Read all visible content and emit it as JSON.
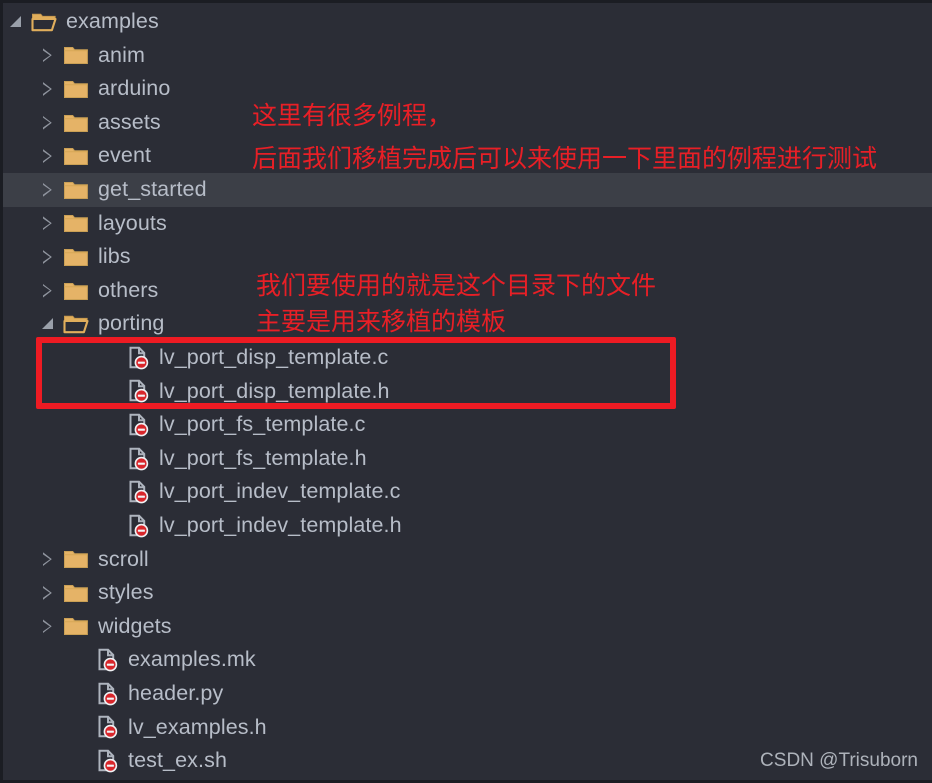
{
  "window": {
    "title": "examples",
    "background": "#2b2d36",
    "highlight_background": "#3c3f47",
    "text_color": "#b7bdc8",
    "folder_color": "#e0ae5c",
    "annotation_color": "#e81f26"
  },
  "tree": {
    "nodes": [
      {
        "label": "examples",
        "type": "folder-open",
        "level": 0,
        "state": "expanded",
        "highlighted": false
      },
      {
        "label": "anim",
        "type": "folder-closed",
        "level": 1,
        "state": "collapsed",
        "highlighted": false
      },
      {
        "label": "arduino",
        "type": "folder-closed",
        "level": 1,
        "state": "collapsed",
        "highlighted": false
      },
      {
        "label": "assets",
        "type": "folder-closed",
        "level": 1,
        "state": "collapsed",
        "highlighted": false
      },
      {
        "label": "event",
        "type": "folder-closed",
        "level": 1,
        "state": "collapsed",
        "highlighted": false
      },
      {
        "label": "get_started",
        "type": "folder-closed",
        "level": 1,
        "state": "collapsed",
        "highlighted": true
      },
      {
        "label": "layouts",
        "type": "folder-closed",
        "level": 1,
        "state": "collapsed",
        "highlighted": false
      },
      {
        "label": "libs",
        "type": "folder-closed",
        "level": 1,
        "state": "collapsed",
        "highlighted": false
      },
      {
        "label": "others",
        "type": "folder-closed",
        "level": 1,
        "state": "collapsed",
        "highlighted": false
      },
      {
        "label": "porting",
        "type": "folder-open",
        "level": 1,
        "state": "expanded",
        "highlighted": false
      },
      {
        "label": "lv_port_disp_template.c",
        "type": "file",
        "level": 2,
        "state": "none",
        "highlighted": false
      },
      {
        "label": "lv_port_disp_template.h",
        "type": "file",
        "level": 2,
        "state": "none",
        "highlighted": false
      },
      {
        "label": "lv_port_fs_template.c",
        "type": "file",
        "level": 2,
        "state": "none",
        "highlighted": false
      },
      {
        "label": "lv_port_fs_template.h",
        "type": "file",
        "level": 2,
        "state": "none",
        "highlighted": false
      },
      {
        "label": "lv_port_indev_template.c",
        "type": "file",
        "level": 2,
        "state": "none",
        "highlighted": false
      },
      {
        "label": "lv_port_indev_template.h",
        "type": "file",
        "level": 2,
        "state": "none",
        "highlighted": false
      },
      {
        "label": "scroll",
        "type": "folder-closed",
        "level": 1,
        "state": "collapsed",
        "highlighted": false
      },
      {
        "label": "styles",
        "type": "folder-closed",
        "level": 1,
        "state": "collapsed",
        "highlighted": false
      },
      {
        "label": "widgets",
        "type": "folder-closed",
        "level": 1,
        "state": "collapsed",
        "highlighted": false
      },
      {
        "label": "examples.mk",
        "type": "file",
        "level": 1,
        "state": "none",
        "highlighted": false
      },
      {
        "label": "header.py",
        "type": "file",
        "level": 1,
        "state": "none",
        "highlighted": false
      },
      {
        "label": "lv_examples.h",
        "type": "file",
        "level": 1,
        "state": "none",
        "highlighted": false
      },
      {
        "label": "test_ex.sh",
        "type": "file",
        "level": 1,
        "state": "none",
        "highlighted": false
      }
    ]
  },
  "annotations": {
    "line1": "这里有很多例程，",
    "line2": "后面我们移植完成后可以来使用一下里面的例程进行测试",
    "line3": "我们要使用的就是这个目录下的文件",
    "line4": "主要是用来移植的模板"
  },
  "watermark": {
    "text": "CSDN @Trisuborn"
  }
}
